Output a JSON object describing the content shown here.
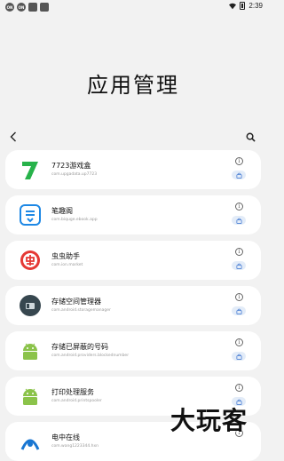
{
  "status_bar": {
    "time": "2:39",
    "left_badges": [
      "ON",
      "ON"
    ]
  },
  "page_title": "应用管理",
  "nav": {
    "back_icon": "chevron-left-icon",
    "search_icon": "search-icon"
  },
  "apps": [
    {
      "name": "7723游戏盒",
      "package": "com.upgadata.up7723",
      "icon": "7723-icon",
      "color": "#27b24a"
    },
    {
      "name": "笔趣阁",
      "package": "com.biquge.ebook.app",
      "icon": "biquge-icon",
      "color": "#1e88e5"
    },
    {
      "name": "虫虫助手",
      "package": "com.ion.market",
      "icon": "chongchong-icon",
      "color": "#e53935"
    },
    {
      "name": "存储空间管理器",
      "package": "com.android.storagemanager",
      "icon": "storage-icon",
      "color": "#455a64"
    },
    {
      "name": "存储已屏蔽的号码",
      "package": "com.android.providers.blockednumber",
      "icon": "android-icon",
      "color": "#8bc34a"
    },
    {
      "name": "打印处理服务",
      "package": "com.android.printspooler",
      "icon": "android-icon",
      "color": "#8bc34a"
    },
    {
      "name": "电中在线",
      "package": "com.wang1223344.hxn",
      "icon": "dianzhong-icon",
      "color": "#1976d2"
    }
  ],
  "watermark": "大玩客"
}
